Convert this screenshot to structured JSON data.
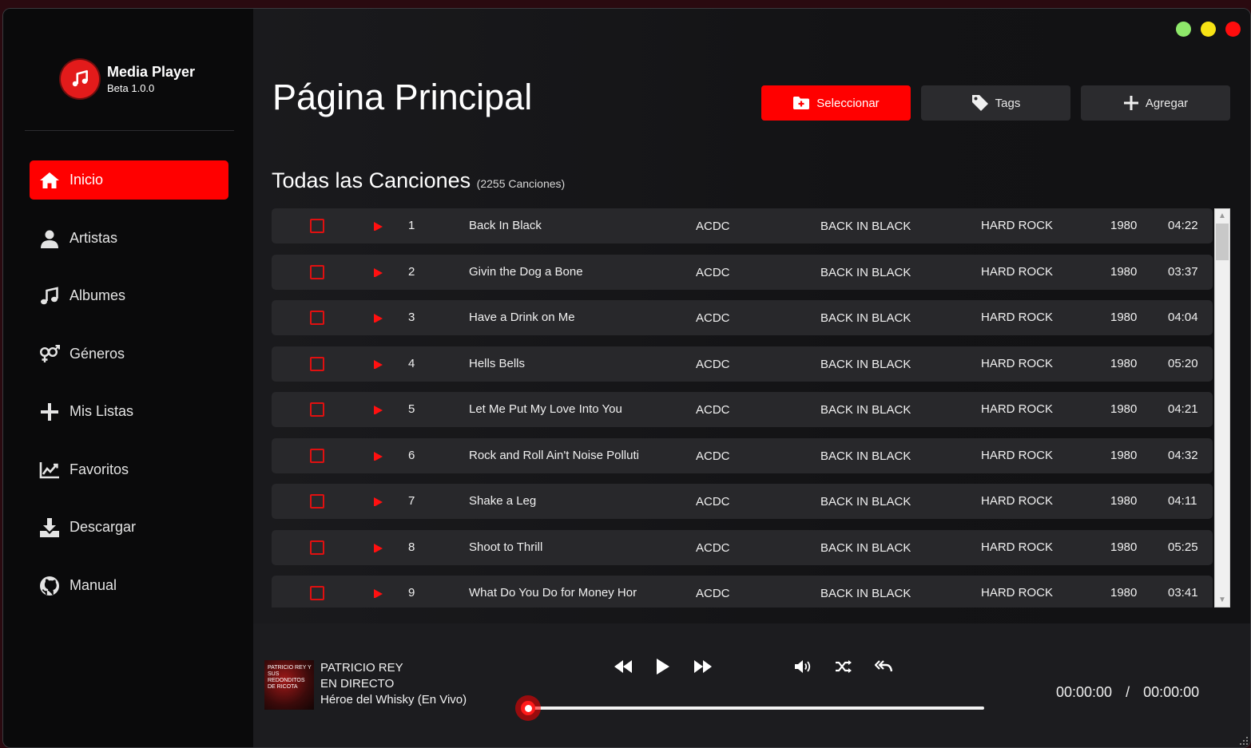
{
  "brand": {
    "title": "Media Player",
    "version": "Beta 1.0.0"
  },
  "window_controls": [
    "#8ee86a",
    "#f7e214",
    "#ff0d0d"
  ],
  "sidebar": {
    "items": [
      {
        "label": "Inicio",
        "icon": "home-icon",
        "active": true
      },
      {
        "label": "Artistas",
        "icon": "user-icon"
      },
      {
        "label": "Albumes",
        "icon": "music-note-icon"
      },
      {
        "label": "Géneros",
        "icon": "gender-icon"
      },
      {
        "label": "Mis Listas",
        "icon": "plus-icon"
      },
      {
        "label": "Favoritos",
        "icon": "chart-line-icon"
      },
      {
        "label": "Descargar",
        "icon": "download-icon"
      },
      {
        "label": "Manual",
        "icon": "github-icon"
      }
    ]
  },
  "header": {
    "title": "Página Principal",
    "buttons": {
      "select": "Seleccionar",
      "tags": "Tags",
      "add": "Agregar"
    }
  },
  "songs_section": {
    "title": "Todas las Canciones",
    "count": "(2255 Canciones)"
  },
  "songs": [
    {
      "n": "1",
      "title": "Back In Black",
      "artist": "ACDC",
      "album": "BACK IN BLACK",
      "genre": "HARD ROCK",
      "year": "1980",
      "duration": "04:22"
    },
    {
      "n": "2",
      "title": "Givin the Dog a Bone",
      "artist": "ACDC",
      "album": "BACK IN BLACK",
      "genre": "HARD ROCK",
      "year": "1980",
      "duration": "03:37"
    },
    {
      "n": "3",
      "title": "Have a Drink on Me",
      "artist": "ACDC",
      "album": "BACK IN BLACK",
      "genre": "HARD ROCK",
      "year": "1980",
      "duration": "04:04"
    },
    {
      "n": "4",
      "title": "Hells Bells",
      "artist": "ACDC",
      "album": "BACK IN BLACK",
      "genre": "HARD ROCK",
      "year": "1980",
      "duration": "05:20"
    },
    {
      "n": "5",
      "title": "Let Me Put My Love Into You",
      "artist": "ACDC",
      "album": "BACK IN BLACK",
      "genre": "HARD ROCK",
      "year": "1980",
      "duration": "04:21"
    },
    {
      "n": "6",
      "title": "Rock and Roll Ain't Noise Polluti",
      "artist": "ACDC",
      "album": "BACK IN BLACK",
      "genre": "HARD ROCK",
      "year": "1980",
      "duration": "04:32"
    },
    {
      "n": "7",
      "title": "Shake a Leg",
      "artist": "ACDC",
      "album": "BACK IN BLACK",
      "genre": "HARD ROCK",
      "year": "1980",
      "duration": "04:11"
    },
    {
      "n": "8",
      "title": "Shoot to Thrill",
      "artist": "ACDC",
      "album": "BACK IN BLACK",
      "genre": "HARD ROCK",
      "year": "1980",
      "duration": "05:25"
    },
    {
      "n": "9",
      "title": "What Do You Do for Money Hor",
      "artist": "ACDC",
      "album": "BACK IN BLACK",
      "genre": "HARD ROCK",
      "year": "1980",
      "duration": "03:41"
    }
  ],
  "player": {
    "artist": "PATRICIO REY",
    "album": "EN DIRECTO",
    "track": "Héroe del Whisky (En Vivo)",
    "current_time": "00:00:00",
    "separator": "/",
    "total_time": "00:00:00",
    "progress": 0,
    "cover_caption": "PATRICIO REY Y SUS REDONDITOS DE RICOTA"
  },
  "accent_color": "#ff0000"
}
